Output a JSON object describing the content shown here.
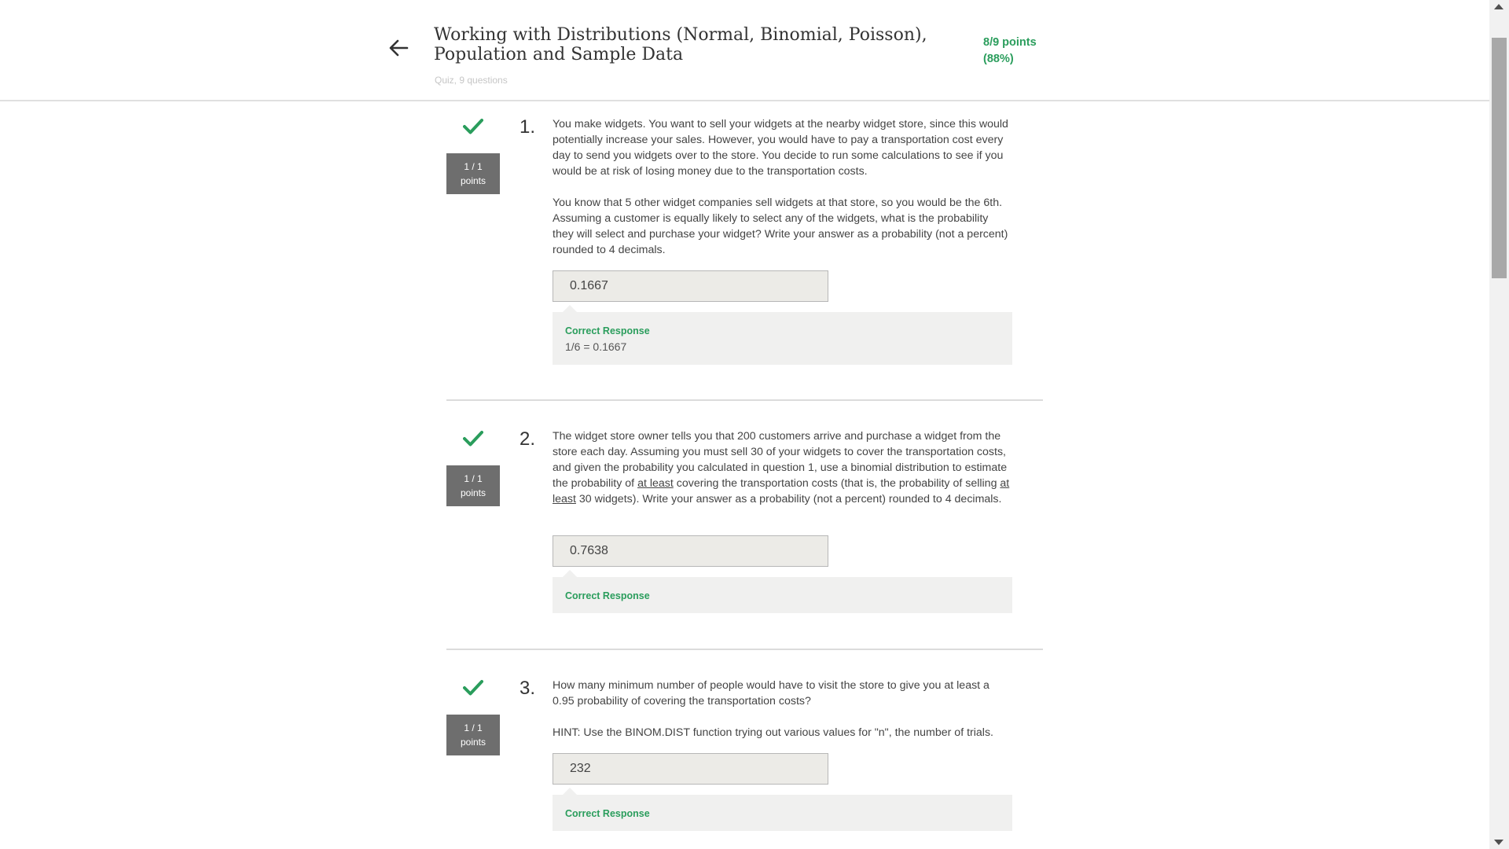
{
  "header": {
    "back_icon": "arrow-left-icon",
    "title": "Working with Distributions (Normal, Binomial, Poisson), Population and Sample Data",
    "subtitle": "Quiz, 9 questions",
    "score_line1": "8/9 points",
    "score_line2": "(88%)"
  },
  "colors": {
    "accent_green": "#2a9d5c",
    "points_box": "#6e6e6e",
    "answer_bg": "#ecebe7",
    "feedback_bg": "#f0f0ef"
  },
  "questions": [
    {
      "number": "1.",
      "status_icon": "checkmark-icon",
      "points_line1": "1 / 1",
      "points_line2": "points",
      "paragraphs": [
        "You make widgets. You want to sell your widgets at the nearby widget store, since this would potentially increase your sales. However, you would have to pay a transportation cost every day to send you widgets over to the store. You decide to run some calculations to see if you would be at risk of losing money due to the transportation costs.",
        "You know that 5 other widget companies sell widgets at that store, so you would be the 6th. Assuming a customer is equally likely to select any of the widgets, what is the probability they will select and purchase your widget? Write your answer as a probability (not a percent) rounded to 4 decimals."
      ],
      "answer": "0.1667",
      "feedback_label": "Correct Response",
      "feedback_text": "1/6 = 0.1667"
    },
    {
      "number": "2.",
      "status_icon": "checkmark-icon",
      "points_line1": "1 / 1",
      "points_line2": "points",
      "text_parts": {
        "a": "The widget store owner tells you that 200 customers arrive and purchase a widget from the store each day. Assuming you must sell 30 of your widgets to cover the transportation costs, and given the probability you calculated in question 1, use a binomial distribution to estimate the probability of ",
        "b": "at least",
        "c": " covering the transportation costs (that is, the probability of selling ",
        "d": "at least",
        "e": " 30 widgets). Write your answer as a probability (not a percent) rounded to 4 decimals."
      },
      "answer": "0.7638",
      "feedback_label": "Correct Response"
    },
    {
      "number": "3.",
      "status_icon": "checkmark-icon",
      "points_line1": "1 / 1",
      "points_line2": "points",
      "paragraphs": [
        "How many minimum number of people would have to visit the store to give you at least a 0.95 probability of covering the transportation costs?",
        "HINT: Use the BINOM.DIST function trying out various values for \"n\", the number of trials."
      ],
      "answer": "232",
      "feedback_label": "Correct Response"
    }
  ]
}
